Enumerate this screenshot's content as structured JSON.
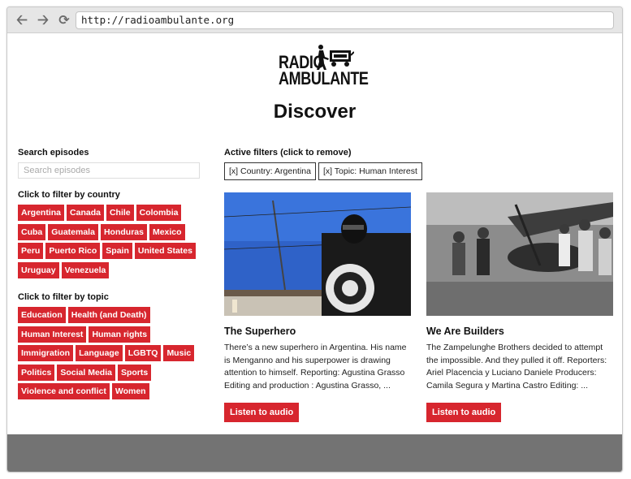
{
  "browser": {
    "url": "http://radioambulante.org",
    "back_icon": "arrow-left",
    "forward_icon": "arrow-right",
    "reload_icon": "reload"
  },
  "logo": {
    "line1": "RADIO",
    "line2": "AMBULANTE"
  },
  "page_title": "Discover",
  "search": {
    "label": "Search episodes",
    "placeholder": "Search episodes",
    "value": ""
  },
  "country_filter": {
    "label": "Click to filter by country",
    "items": [
      "Argentina",
      "Canada",
      "Chile",
      "Colombia",
      "Cuba",
      "Guatemala",
      "Honduras",
      "Mexico",
      "Peru",
      "Puerto Rico",
      "Spain",
      "United States",
      "Uruguay",
      "Venezuela"
    ]
  },
  "topic_filter": {
    "label": "Click to filter by topic",
    "items": [
      "Education",
      "Health (and Death)",
      "Human Interest",
      "Human rights",
      "Immigration",
      "Language",
      "LGBTQ",
      "Music",
      "Politics",
      "Social Media",
      "Sports",
      "Violence and conflict",
      "Women"
    ]
  },
  "active_filters": {
    "label": "Active filters (click to remove)",
    "items": [
      "[x] Country: Argentina",
      "[x] Topic: Human Interest"
    ]
  },
  "episodes": [
    {
      "title": "The Superhero",
      "description": "There’s a new superhero in Argentina. His name is Menganno and his superpower is drawing attention to himself. Reporting: Agustina Grasso Editing and production : Agustina Grasso, ...",
      "button": "Listen to audio"
    },
    {
      "title": "We Are Builders",
      "description": "The Zampelunghe Brothers decided to attempt the impossible. And they pulled it off. Reporters: Ariel Placencia y Luciano Daniele Producers: Camila Segura y Martina Castro Editing: ...",
      "button": "Listen to audio"
    }
  ],
  "colors": {
    "accent": "#d7262e",
    "footer": "#737373",
    "chrome": "#e6e6e6"
  }
}
